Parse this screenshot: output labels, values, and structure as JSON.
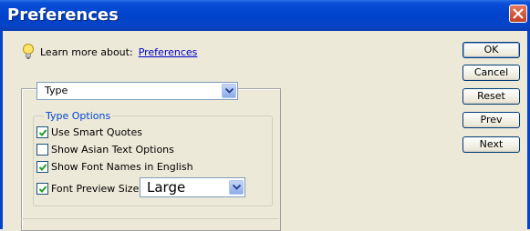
{
  "window": {
    "title": "Preferences"
  },
  "learn_more": {
    "label": "Learn more about:",
    "link": "Preferences"
  },
  "section_dropdown": {
    "value": "Type"
  },
  "type_options": {
    "group_label": "Type Options",
    "checkboxes": [
      {
        "label": "Use Smart Quotes",
        "checked": true
      },
      {
        "label": "Show Asian Text Options",
        "checked": false
      },
      {
        "label": "Show Font Names in English",
        "checked": true
      },
      {
        "label": "Font Preview Size:",
        "checked": true
      }
    ],
    "preview_size": {
      "value": "Large"
    }
  },
  "buttons": {
    "ok": "OK",
    "cancel": "Cancel",
    "reset": "Reset",
    "prev": "Prev",
    "next": "Next"
  },
  "colors": {
    "title_bar": "#0042cc",
    "link": "#0000cc",
    "group_label": "#0046d5",
    "close_button": "#c63f23"
  }
}
